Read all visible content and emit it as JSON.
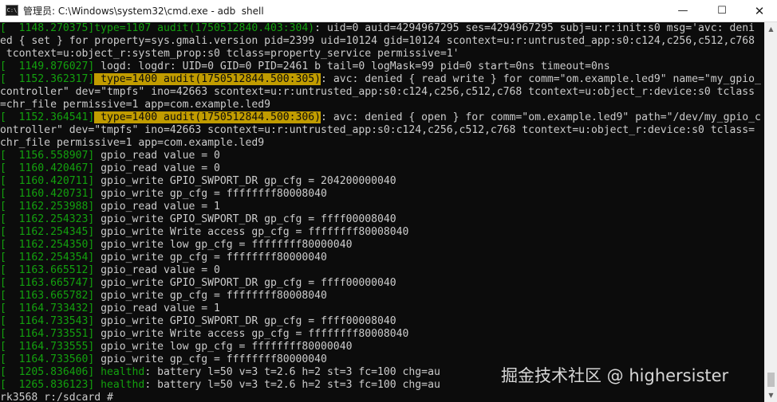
{
  "window": {
    "title": "管理员: C:\\Windows\\system32\\cmd.exe - adb  shell",
    "icon_text": "C:\\",
    "minimize_glyph": "—",
    "maximize_glyph": "☐",
    "close_glyph": "✕"
  },
  "colors": {
    "background": "#0c0c0c",
    "text": "#cccccc",
    "timestamp_green": "#13a10e",
    "highlight_yellow": "#c19c00"
  },
  "console": {
    "lines": [
      {
        "ts": "[  1148.270375]",
        "tag": "type=1107 audit(1750512840.403:304)",
        "tag_style": "g",
        "rest": ": uid=0 auid=4294967295 ses=4294967295 subj=u:r:init:s0 msg='avc: deni"
      },
      {
        "ts": "",
        "tag": "",
        "tag_style": "",
        "rest": "ed { set } for property=sys.gmali.version pid=2399 uid=10124 gid=10124 scontext=u:r:untrusted_app:s0:c124,c256,c512,c768"
      },
      {
        "ts": "",
        "tag": "",
        "tag_style": "",
        "rest": " tcontext=u:object_r:system_prop:s0 tclass=property_service permissive=1'"
      },
      {
        "ts": "[  1149.876027]",
        "tag": "",
        "tag_style": "",
        "rest": " logd: logdr: UID=0 GID=0 PID=2461 b tail=0 logMask=99 pid=0 start=0ns timeout=0ns"
      },
      {
        "ts": "[  1152.362317]",
        "tag": " type=1400 audit(1750512844.500:305)",
        "tag_style": "y",
        "rest": ": avc: denied { read write } for comm=\"om.example.led9\" name=\"my_gpio_"
      },
      {
        "ts": "",
        "tag": "",
        "tag_style": "",
        "rest": "controller\" dev=\"tmpfs\" ino=42663 scontext=u:r:untrusted_app:s0:c124,c256,c512,c768 tcontext=u:object_r:device:s0 tclass"
      },
      {
        "ts": "",
        "tag": "",
        "tag_style": "",
        "rest": "=chr_file permissive=1 app=com.example.led9"
      },
      {
        "ts": "[  1152.364541]",
        "tag": " type=1400 audit(1750512844.500:306)",
        "tag_style": "y",
        "rest": ": avc: denied { open } for comm=\"om.example.led9\" path=\"/dev/my_gpio_c"
      },
      {
        "ts": "",
        "tag": "",
        "tag_style": "",
        "rest": "ontroller\" dev=\"tmpfs\" ino=42663 scontext=u:r:untrusted_app:s0:c124,c256,c512,c768 tcontext=u:object_r:device:s0 tclass="
      },
      {
        "ts": "",
        "tag": "",
        "tag_style": "",
        "rest": "chr_file permissive=1 app=com.example.led9"
      },
      {
        "ts": "[  1156.558907]",
        "tag": "",
        "tag_style": "",
        "rest": " gpio_read value = 0"
      },
      {
        "ts": "[  1160.420467]",
        "tag": "",
        "tag_style": "",
        "rest": " gpio_read value = 0"
      },
      {
        "ts": "[  1160.420711]",
        "tag": "",
        "tag_style": "",
        "rest": " gpio_write GPIO_SWPORT_DR gp_cfg = 204200000040"
      },
      {
        "ts": "[  1160.420731]",
        "tag": "",
        "tag_style": "",
        "rest": " gpio_write gp_cfg = ffffffff80008040"
      },
      {
        "ts": "[  1162.253988]",
        "tag": "",
        "tag_style": "",
        "rest": " gpio_read value = 1"
      },
      {
        "ts": "[  1162.254323]",
        "tag": "",
        "tag_style": "",
        "rest": " gpio_write GPIO_SWPORT_DR gp_cfg = ffff00008040"
      },
      {
        "ts": "[  1162.254345]",
        "tag": "",
        "tag_style": "",
        "rest": " gpio_write Write access gp_cfg = ffffffff80008040"
      },
      {
        "ts": "[  1162.254350]",
        "tag": "",
        "tag_style": "",
        "rest": " gpio_write low gp_cfg = ffffffff80000040"
      },
      {
        "ts": "[  1162.254354]",
        "tag": "",
        "tag_style": "",
        "rest": " gpio_write gp_cfg = ffffffff80000040"
      },
      {
        "ts": "[  1163.665512]",
        "tag": "",
        "tag_style": "",
        "rest": " gpio_read value = 0"
      },
      {
        "ts": "[  1163.665747]",
        "tag": "",
        "tag_style": "",
        "rest": " gpio_write GPIO_SWPORT_DR gp_cfg = ffff00000040"
      },
      {
        "ts": "[  1163.665782]",
        "tag": "",
        "tag_style": "",
        "rest": " gpio_write gp_cfg = ffffffff80008040"
      },
      {
        "ts": "[  1164.733432]",
        "tag": "",
        "tag_style": "",
        "rest": " gpio_read value = 1"
      },
      {
        "ts": "[  1164.733543]",
        "tag": "",
        "tag_style": "",
        "rest": " gpio_write GPIO_SWPORT_DR gp_cfg = ffff00008040"
      },
      {
        "ts": "[  1164.733551]",
        "tag": "",
        "tag_style": "",
        "rest": " gpio_write Write access gp_cfg = ffffffff80008040"
      },
      {
        "ts": "[  1164.733555]",
        "tag": "",
        "tag_style": "",
        "rest": " gpio_write low gp_cfg = ffffffff80000040"
      },
      {
        "ts": "[  1164.733560]",
        "tag": "",
        "tag_style": "",
        "rest": " gpio_write gp_cfg = ffffffff80000040"
      },
      {
        "ts": "[  1205.836406]",
        "tag": " healthd",
        "tag_style": "g",
        "rest": ": battery l=50 v=3 t=2.6 h=2 st=3 fc=100 chg=au"
      },
      {
        "ts": "[  1265.836123]",
        "tag": " healthd",
        "tag_style": "g",
        "rest": ": battery l=50 v=3 t=2.6 h=2 st=3 fc=100 chg=au"
      },
      {
        "ts": "",
        "tag": "",
        "tag_style": "",
        "rest": "rk3568_r:/sdcard #"
      }
    ]
  },
  "watermark": "掘金技术社区 @ highersister",
  "scrollbar": {
    "up_glyph": "▲",
    "down_glyph": "▼"
  }
}
